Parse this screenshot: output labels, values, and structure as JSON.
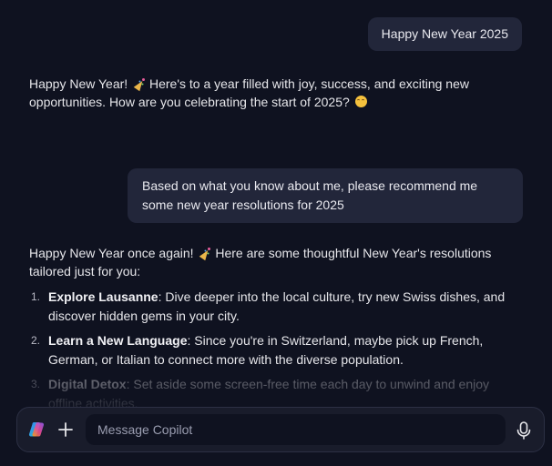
{
  "conversation": {
    "user_message_1": "Happy New Year 2025",
    "assistant_message_1": {
      "part1": "Happy New Year!",
      "part2": "Here's to a year filled with joy, success, and exciting new opportunities. How are you celebrating the start of 2025?",
      "emoji_1": "party-popper-icon",
      "emoji_2": "smiling-face-icon"
    },
    "user_message_2": "Based on what you know about me, please recommend me some new year resolutions for 2025",
    "assistant_message_2": {
      "intro_part1": "Happy New Year once again!",
      "intro_part2": "Here are some thoughtful New Year's resolutions tailored just for you:",
      "emoji": "party-popper-icon",
      "resolutions": [
        {
          "number": "1.",
          "title": "Explore Lausanne",
          "text": ": Dive deeper into the local culture, try new Swiss dishes, and discover hidden gems in your city."
        },
        {
          "number": "2.",
          "title": "Learn a New Language",
          "text": ": Since you're in Switzerland, maybe pick up French, German, or Italian to connect more with the diverse population."
        },
        {
          "number": "3.",
          "title": "Digital Detox",
          "text": ": Set aside some screen-free time each day to unwind and enjoy offline activities."
        }
      ]
    }
  },
  "composer": {
    "placeholder": "Message Copilot",
    "value": "",
    "logo_icon": "copilot-logo-icon",
    "plus_icon": "plus-icon",
    "mic_icon": "microphone-icon"
  },
  "colors": {
    "background": "#0f1220",
    "user_bubble": "#22263a",
    "composer": "#191c2b",
    "text": "#e6e6ea"
  }
}
